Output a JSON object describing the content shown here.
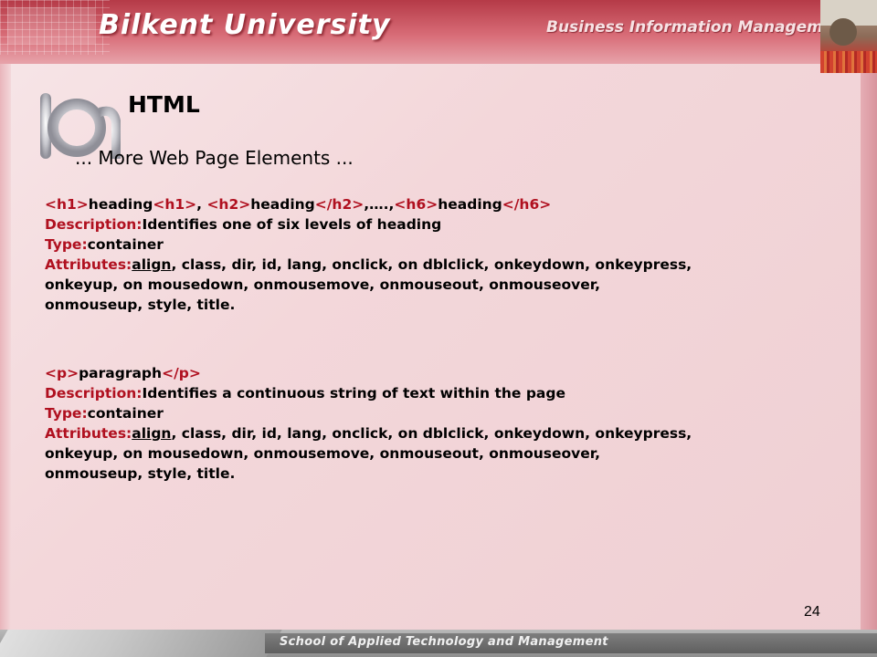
{
  "header": {
    "university": "Bilkent University",
    "department": "Business Information Management"
  },
  "slide": {
    "title": "HTML",
    "subtitle": "... More Web Page Elements ..."
  },
  "sections": [
    {
      "tag_line": {
        "t1": "<h1>",
        "w1": "heading",
        "t2": "<h1>",
        "s1": ", ",
        "t3": "<h2>",
        "w2": "heading",
        "t4": "</h2>",
        "s2": ",….,",
        "t5": "<h6>",
        "w3": "heading",
        "t6": "</h6>"
      },
      "description_label": "Description:",
      "description": "Identifies one of six levels of heading",
      "type_label": "Type:",
      "type": "container",
      "attributes_label": "Attributes:",
      "attr_first": "align",
      "attr_line1_rest": ", class, dir, id, lang, onclick, on dblclick, onkeydown, onkeypress,",
      "attr_line2": "onkeyup, on mousedown, onmousemove, onmouseout, onmouseover,",
      "attr_line3": "onmouseup, style, title."
    },
    {
      "tag_line": {
        "t1": "<p>",
        "w1": "paragraph",
        "t2": "</p>"
      },
      "description_label": "Description:",
      "description": "Identifies a continuous string of text within the page",
      "type_label": "Type:",
      "type": "container",
      "attributes_label": "Attributes:",
      "attr_first": "align",
      "attr_line1_rest": ", class, dir, id, lang, onclick, on dblclick, onkeydown, onkeypress,",
      "attr_line2": "onkeyup, on mousedown, onmousemove, onmouseout, onmouseover,",
      "attr_line3": "onmouseup, style, title."
    }
  ],
  "page_number": "24",
  "footer": {
    "school": "School of Applied Technology and Management"
  },
  "colors": {
    "accent_red": "#b0101f",
    "banner": "#c44d5a",
    "background": "#f3d9dc"
  }
}
